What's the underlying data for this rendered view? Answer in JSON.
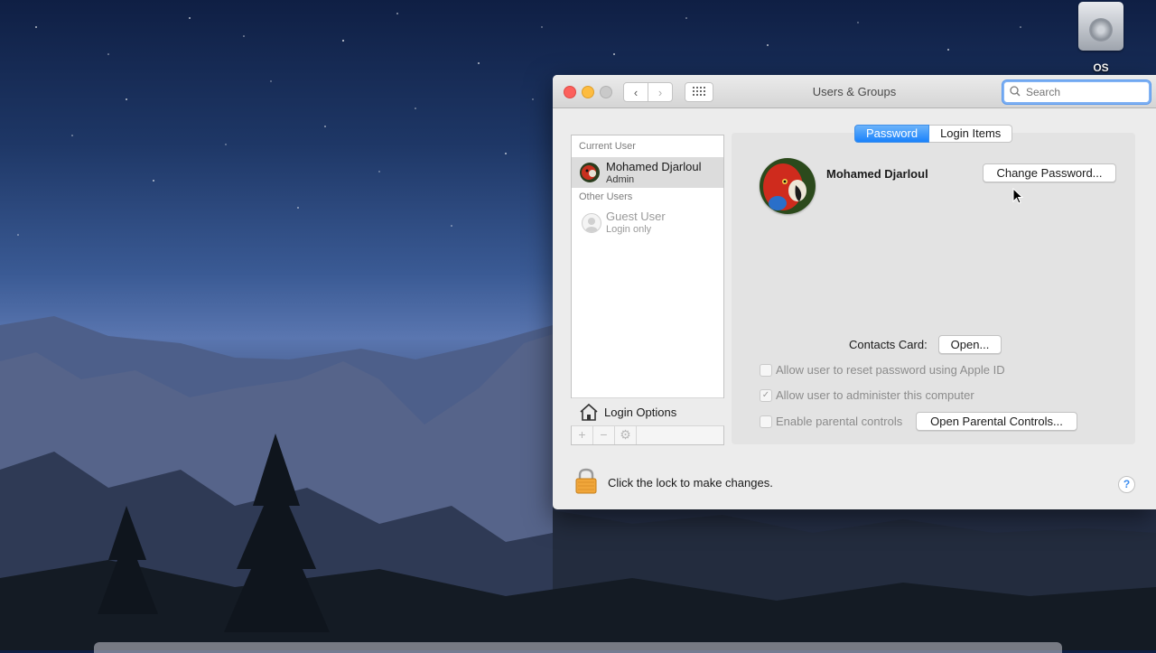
{
  "desktop": {
    "disk_label": "OS"
  },
  "window": {
    "title": "Users & Groups",
    "search_placeholder": "Search"
  },
  "sidebar": {
    "current_user_header": "Current User",
    "current_user": {
      "name": "Mohamed Djarloul",
      "role": "Admin"
    },
    "other_users_header": "Other Users",
    "other_users": [
      {
        "name": "Guest User",
        "role": "Login only"
      }
    ],
    "login_options_label": "Login Options"
  },
  "tabs": [
    {
      "label": "Password",
      "active": true
    },
    {
      "label": "Login Items",
      "active": false
    }
  ],
  "detail": {
    "user_name": "Mohamed Djarloul",
    "change_password_label": "Change Password...",
    "contacts_card_label": "Contacts Card:",
    "open_label": "Open...",
    "options": [
      {
        "label": "Allow user to reset password using Apple ID",
        "checked": false
      },
      {
        "label": "Allow user to administer this computer",
        "checked": true
      },
      {
        "label": "Enable parental controls",
        "checked": false
      }
    ],
    "open_parental_label": "Open Parental Controls..."
  },
  "footer": {
    "lock_text": "Click the lock to make changes.",
    "help_label": "?"
  },
  "colors": {
    "accent": "#1a82fb",
    "close": "#fc605c",
    "minimize": "#fdbc40",
    "lock": "#f0a63a"
  }
}
